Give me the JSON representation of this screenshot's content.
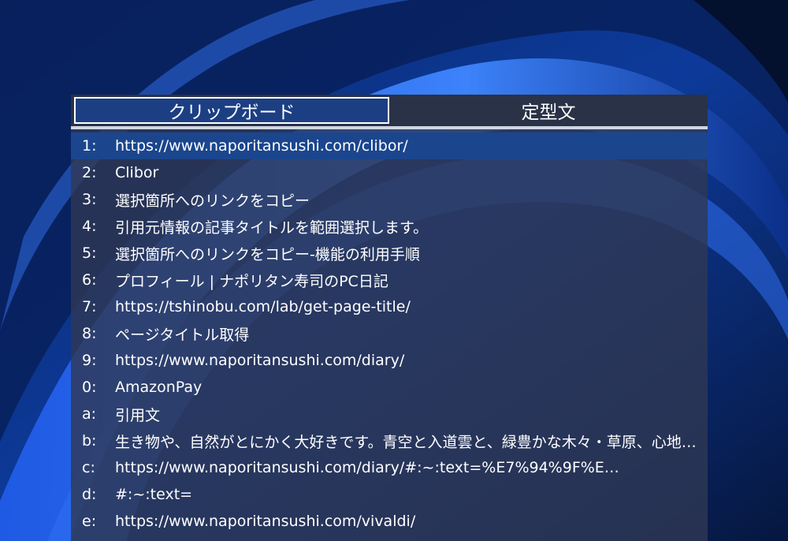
{
  "tabs": [
    {
      "label": "クリップボード",
      "active": true
    },
    {
      "label": "定型文",
      "active": false
    }
  ],
  "items": [
    {
      "key": "1:",
      "text": "https://www.naporitansushi.com/clibor/"
    },
    {
      "key": "2:",
      "text": "Clibor"
    },
    {
      "key": "3:",
      "text": "選択箇所へのリンクをコピー"
    },
    {
      "key": "4:",
      "text": "引用元情報の記事タイトルを範囲選択します。"
    },
    {
      "key": "5:",
      "text": "選択箇所へのリンクをコピー-機能の利用手順"
    },
    {
      "key": "6:",
      "text": "プロフィール | ナポリタン寿司のPC日記"
    },
    {
      "key": "7:",
      "text": "https://tshinobu.com/lab/get-page-title/"
    },
    {
      "key": "8:",
      "text": "ページタイトル取得"
    },
    {
      "key": "9:",
      "text": "https://www.naporitansushi.com/diary/"
    },
    {
      "key": "0:",
      "text": "AmazonPay"
    },
    {
      "key": "a:",
      "text": "引用文"
    },
    {
      "key": "b:",
      "text": "生き物や、自然がとにかく大好きです。青空と入道雲と、緑豊かな木々・草原、心地…"
    },
    {
      "key": "c:",
      "text": "https://www.naporitansushi.com/diary/#:~:text=%E7%94%9F%E…"
    },
    {
      "key": "d:",
      "text": "#:~:text="
    },
    {
      "key": "e:",
      "text": "https://www.naporitansushi.com/vivaldi/"
    }
  ],
  "colors": {
    "selected_row": "#1b468e",
    "panel": "#303854",
    "accent": "#ffffff"
  }
}
